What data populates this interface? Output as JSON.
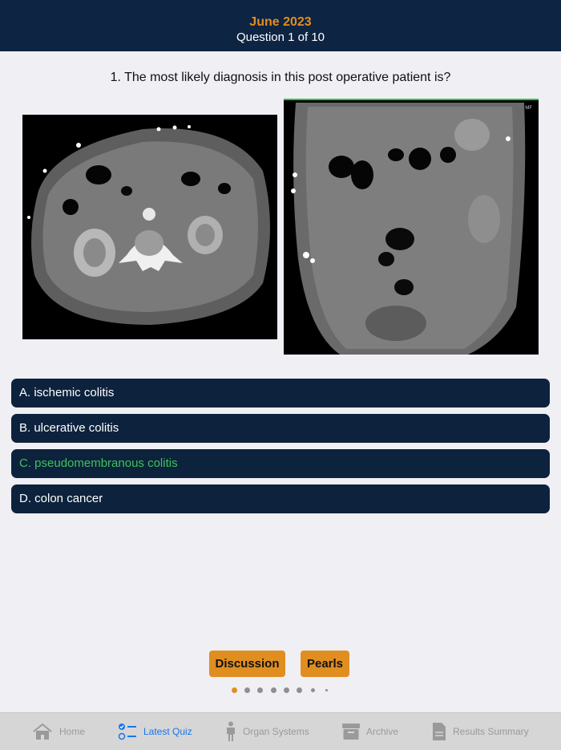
{
  "header": {
    "month": "June 2023",
    "question_counter": "Question 1 of 10"
  },
  "question": {
    "text": "1. The most likely diagnosis in this post operative patient is?"
  },
  "images": [
    {
      "name": "axial-ct-image",
      "icon": "ct-scan-axial"
    },
    {
      "name": "coronal-ct-image",
      "icon": "ct-scan-coronal",
      "corner_label": "MF"
    }
  ],
  "answers": [
    {
      "label": "A. ischemic colitis"
    },
    {
      "label": "B. ulcerative colitis"
    },
    {
      "label": "C. pseudomembranous colitis",
      "state": "correct"
    },
    {
      "label": "D. colon cancer"
    }
  ],
  "buttons": {
    "discussion": "Discussion",
    "pearls": "Pearls"
  },
  "pager": {
    "total": 8,
    "current": 1
  },
  "tabbar": {
    "items": [
      {
        "label": "Home",
        "icon": "home-icon"
      },
      {
        "label": "Latest Quiz",
        "icon": "checklist-icon",
        "active": true
      },
      {
        "label": "Organ Systems",
        "icon": "person-icon"
      },
      {
        "label": "Archive",
        "icon": "archive-box-icon"
      },
      {
        "label": "Results Summary",
        "icon": "document-icon"
      }
    ]
  },
  "colors": {
    "header_bg": "#0d2442",
    "accent_orange": "#e48d20",
    "correct_green": "#3fc35a",
    "tab_active": "#1a75e8"
  }
}
